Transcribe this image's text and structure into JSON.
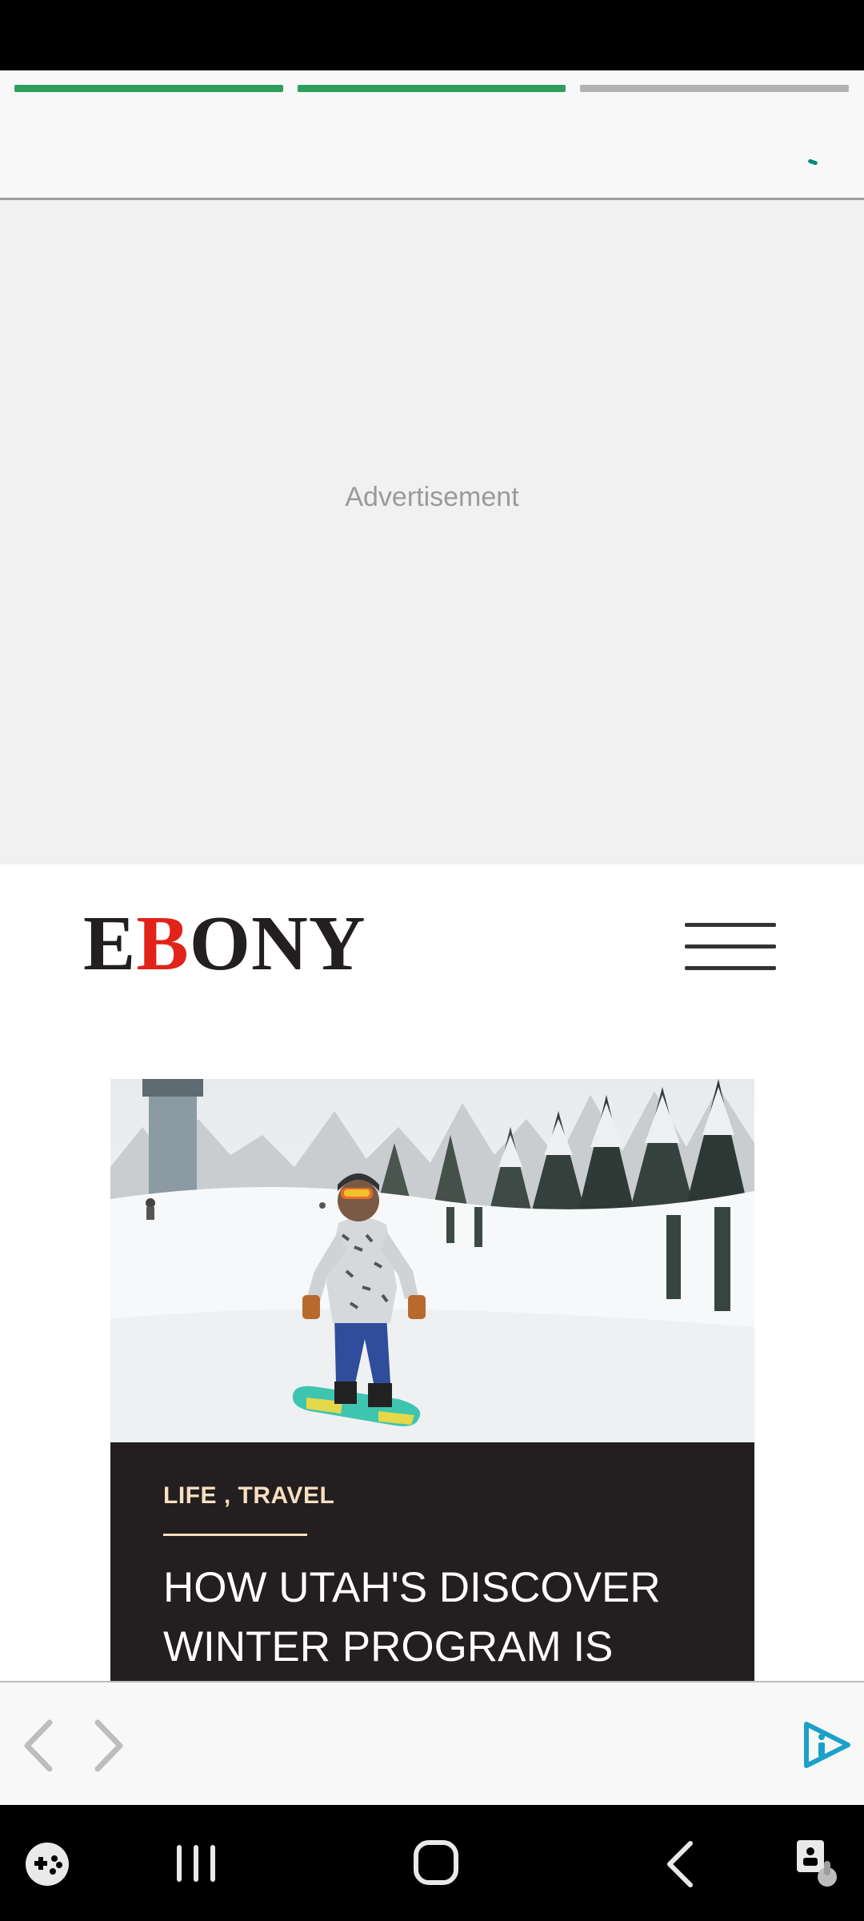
{
  "story_header": {
    "progress": [
      1,
      1,
      0
    ],
    "colors": {
      "complete": "#2e9e5b",
      "pending": "#b3b3b3",
      "loader": "#00897b"
    }
  },
  "ad": {
    "label": "Advertisement"
  },
  "site": {
    "logo_letters": [
      {
        "char": "E",
        "color": "#231f20"
      },
      {
        "char": "B",
        "color": "#e2231a"
      },
      {
        "char": "O",
        "color": "#231f20"
      },
      {
        "char": "N",
        "color": "#231f20"
      },
      {
        "char": "Y",
        "color": "#231f20"
      }
    ],
    "menu_icon": "hamburger-menu-icon"
  },
  "article": {
    "category": "LIFE , TRAVEL",
    "title": "HOW UTAH'S DISCOVER WINTER PROGRAM IS",
    "image_subject": "snowboarder-on-ski-slope"
  },
  "toolbar": {
    "back_icon": "chevron-left-icon",
    "forward_icon": "chevron-right-icon",
    "brand_icon": "play-info-icon",
    "accent_color": "#1ba0c9"
  },
  "system_nav": {
    "icons": [
      "game-launcher-icon",
      "recent-apps-icon",
      "home-icon",
      "back-icon",
      "accessibility-icon"
    ]
  }
}
